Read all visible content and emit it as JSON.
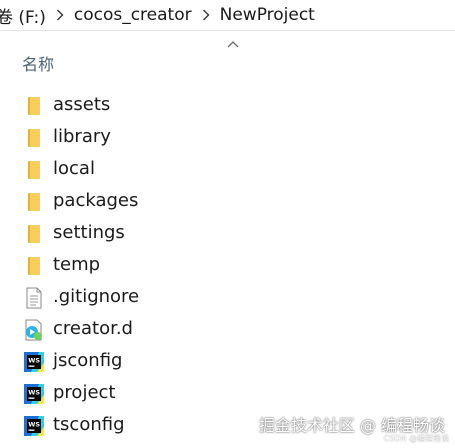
{
  "breadcrumb": {
    "items": [
      "卷 (F:)",
      "cocos_creator",
      "NewProject"
    ]
  },
  "header": {
    "column_name": "名称"
  },
  "files": [
    {
      "name": "assets",
      "icon": "folder-icon"
    },
    {
      "name": "library",
      "icon": "folder-icon"
    },
    {
      "name": "local",
      "icon": "folder-icon"
    },
    {
      "name": "packages",
      "icon": "folder-icon"
    },
    {
      "name": "settings",
      "icon": "folder-icon"
    },
    {
      "name": "temp",
      "icon": "folder-icon"
    },
    {
      "name": ".gitignore",
      "icon": "text-file-icon"
    },
    {
      "name": "creator.d",
      "icon": "media-file-icon"
    },
    {
      "name": "jsconfig",
      "icon": "webstorm-file-icon"
    },
    {
      "name": "project",
      "icon": "webstorm-file-icon"
    },
    {
      "name": "tsconfig",
      "icon": "webstorm-file-icon"
    }
  ],
  "watermark": {
    "text": "掘金技术社区 @ 编程畅谈",
    "small": "CSDN @编程畅谈"
  },
  "colors": {
    "folder": "#f7cf5a",
    "folder_dark": "#e6b23c",
    "header_text": "#4c607a",
    "ws_blue": "#1e6fd9",
    "ws_cyan": "#2fd0e8",
    "ws_yellow": "#f5e23a"
  }
}
